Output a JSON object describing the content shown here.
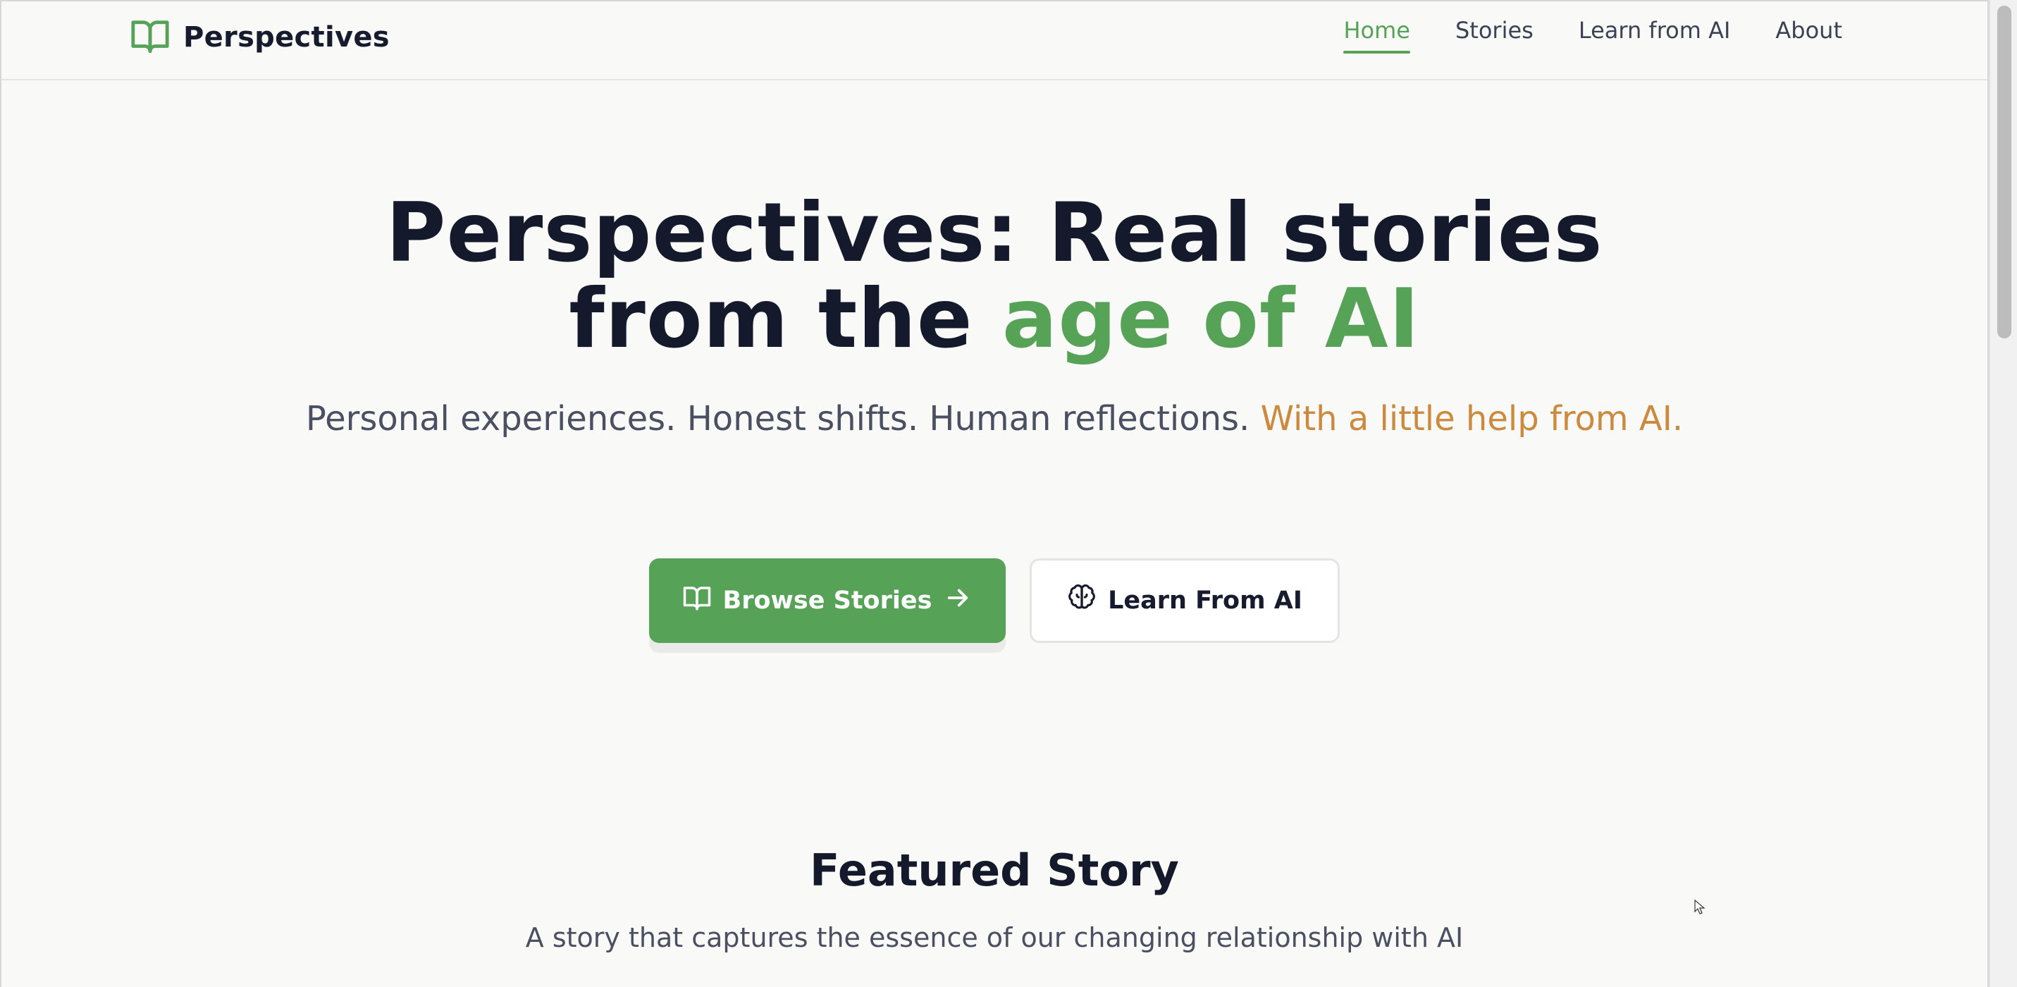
{
  "brand": {
    "name": "Perspectives",
    "icon": "book-open-icon"
  },
  "nav": {
    "items": [
      {
        "label": "Home",
        "active": true
      },
      {
        "label": "Stories",
        "active": false
      },
      {
        "label": "Learn from AI",
        "active": false
      },
      {
        "label": "About",
        "active": false
      }
    ]
  },
  "hero": {
    "title_line1": "Perspectives: Real stories",
    "title_line2_prefix": "from the ",
    "title_line2_highlight": "age of AI",
    "subtitle_main": "Personal experiences. Honest shifts. Human reflections.",
    "subtitle_highlight": "With a little help from AI."
  },
  "buttons": {
    "primary": {
      "label": "Browse Stories",
      "icon": "book-open-icon",
      "trailing_icon": "arrow-right-icon"
    },
    "secondary": {
      "label": "Learn From AI",
      "icon": "brain-icon"
    }
  },
  "featured": {
    "title": "Featured Story",
    "subtitle": "A story that captures the essence of our changing relationship with AI"
  },
  "colors": {
    "accent_green": "#56a257",
    "accent_orange": "#cc8a3e",
    "text_dark": "#141a2c",
    "background": "#f9f9f7"
  }
}
